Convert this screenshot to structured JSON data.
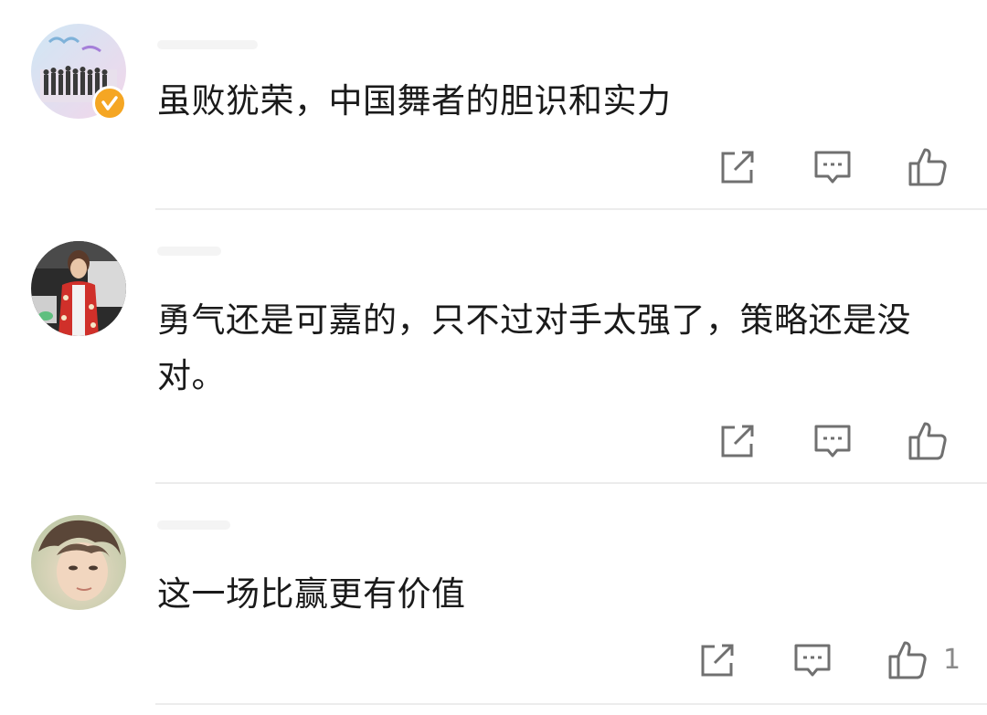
{
  "comments": [
    {
      "text": "虽败犹荣，中国舞者的胆识和实力",
      "verified": true,
      "avatar": "group-photo-avatar",
      "actions": [
        "share-icon",
        "comment-icon",
        "like-icon"
      ],
      "like_count": ""
    },
    {
      "text": "勇气还是可嘉的，只不过对手太强了，策略还是没对。",
      "verified": false,
      "avatar": "person-photo-avatar",
      "actions": [
        "share-icon",
        "comment-icon",
        "like-icon"
      ],
      "like_count": ""
    },
    {
      "text": "这一场比赢更有价值",
      "verified": false,
      "avatar": "portrait-photo-avatar",
      "actions": [
        "share-icon",
        "comment-icon",
        "like-icon"
      ],
      "like_count": "1"
    }
  ],
  "colors": {
    "icon": "#707070",
    "text": "#1a1a1a",
    "divider": "#ececec",
    "verified": "#f5a623"
  }
}
